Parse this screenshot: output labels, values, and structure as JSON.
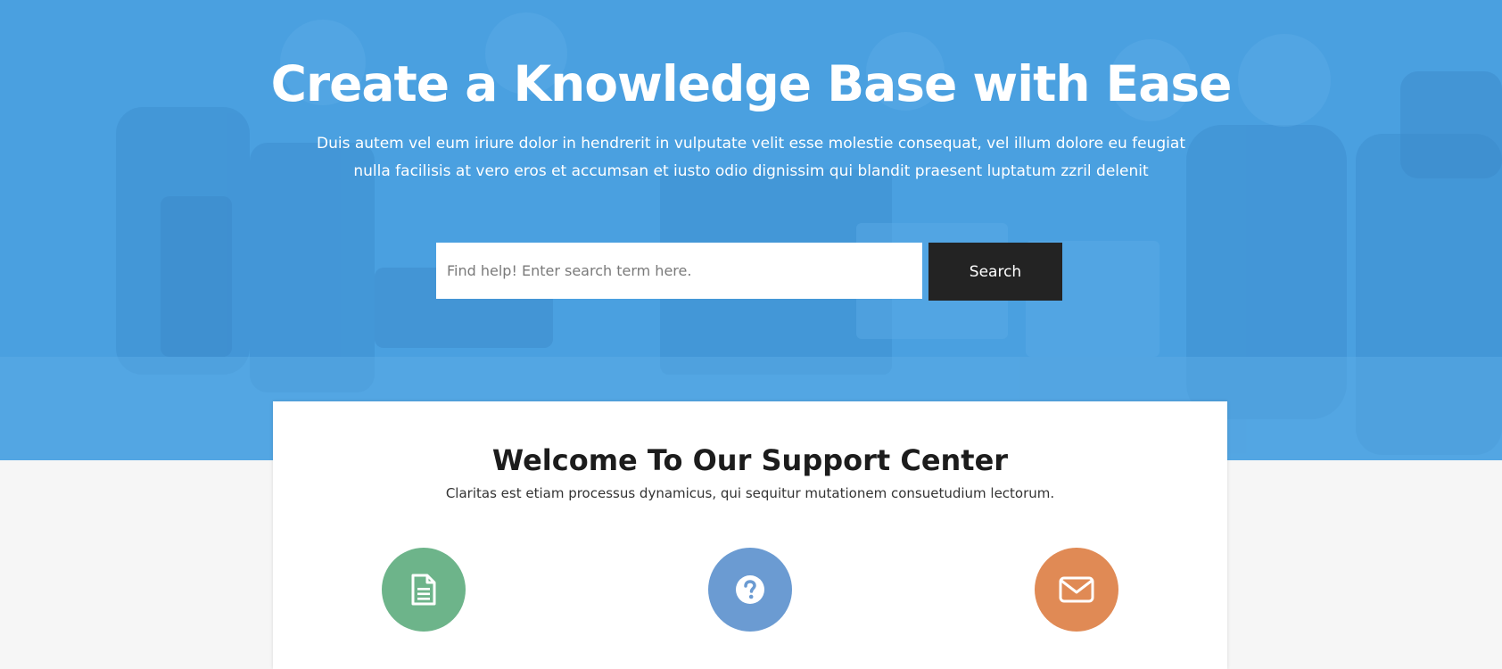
{
  "hero": {
    "title": "Create a Knowledge Base with Ease",
    "subtitle": "Duis autem vel eum iriure dolor in hendrerit in vulputate velit esse molestie consequat, vel illum dolore eu feugiat nulla facilisis at vero eros et accumsan et iusto odio dignissim qui blandit praesent luptatum zzril delenit",
    "background_color": "#4aa0e0"
  },
  "search": {
    "placeholder": "Find help! Enter search term here.",
    "value": "",
    "button_label": "Search"
  },
  "support": {
    "title": "Welcome To Our Support Center",
    "subtitle": "Claritas est etiam processus dynamicus, qui sequitur mutationem consuetudium lectorum.",
    "features": [
      {
        "icon": "document-icon",
        "color": "#6db48a"
      },
      {
        "icon": "question-icon",
        "color": "#6b9bd2"
      },
      {
        "icon": "envelope-icon",
        "color": "#e08a55"
      }
    ]
  }
}
